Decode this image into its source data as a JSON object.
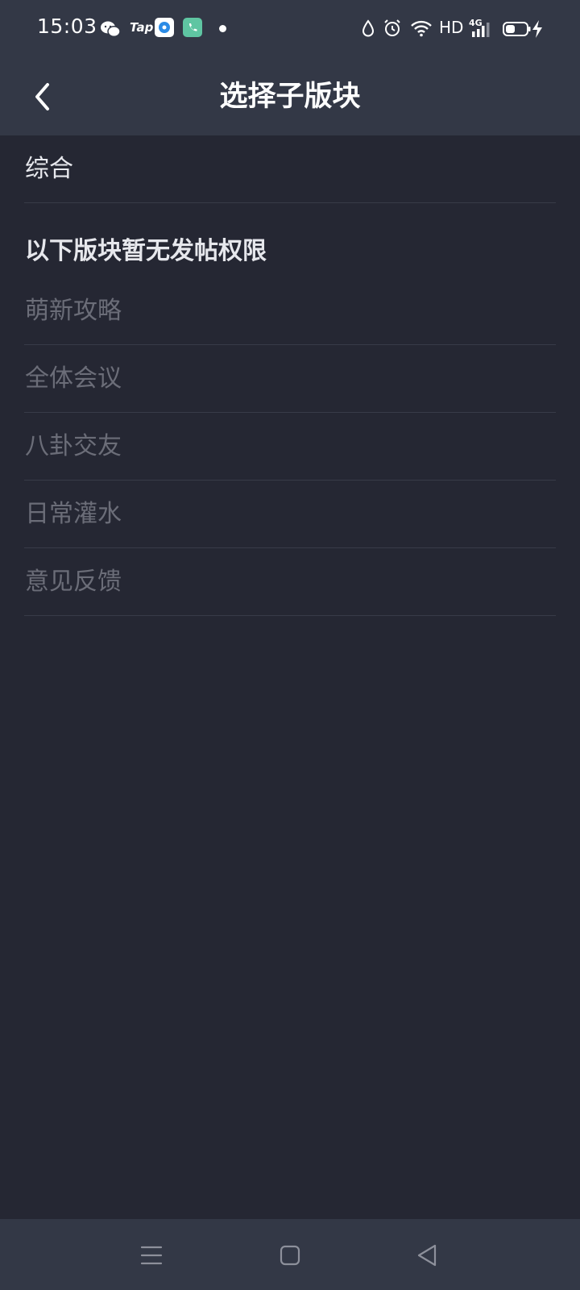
{
  "status_bar": {
    "time": "15:03",
    "tap_label": "Tap",
    "hd_label": "HD",
    "network_label": "4G",
    "icons": [
      "wechat-icon",
      "tap-icon",
      "browser-app-icon",
      "phone-app-icon",
      "notification-dot-icon",
      "water-drop-icon",
      "alarm-icon",
      "wifi-icon",
      "signal-icon",
      "battery-icon",
      "charging-icon"
    ]
  },
  "header": {
    "title": "选择子版块",
    "back_icon": "back-chevron-icon"
  },
  "list": {
    "enabled_items": [
      {
        "label": "综合"
      }
    ],
    "section_title": "以下版块暂无发帖权限",
    "disabled_items": [
      {
        "label": "萌新攻略"
      },
      {
        "label": "全体会议"
      },
      {
        "label": "八卦交友"
      },
      {
        "label": "日常灌水"
      },
      {
        "label": "意见反馈"
      }
    ]
  },
  "navbar": {
    "icons": [
      "menu-icon",
      "home-square-icon",
      "back-triangle-icon"
    ]
  },
  "colors": {
    "background": "#252733",
    "bar": "#333846",
    "enabled_text": "#e8e9ee",
    "disabled_text": "#6b6d78",
    "divider": "#383b48"
  }
}
